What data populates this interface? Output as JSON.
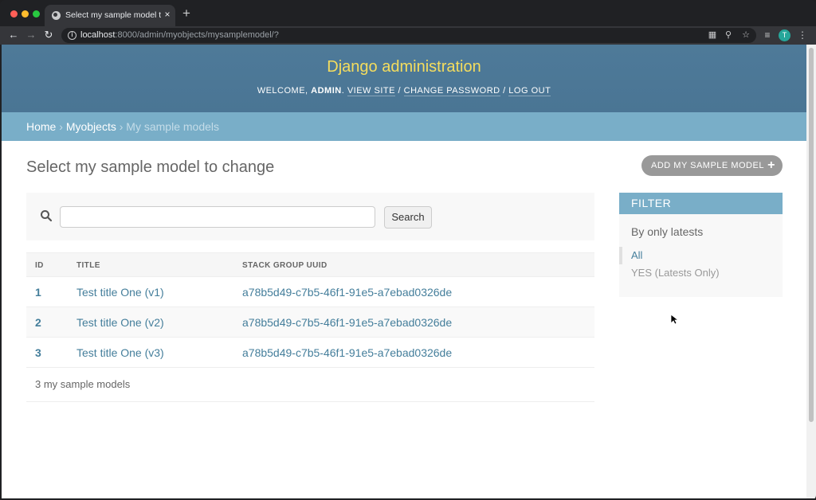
{
  "browser": {
    "tab_title": "Select my sample model to change",
    "tab_close": "×",
    "new_tab": "+",
    "url_host": "localhost",
    "url_rest": ":8000/admin/myobjects/mysamplemodel/?",
    "avatar_letter": "T",
    "icons": [
      "back-icon",
      "forward-icon",
      "reload-icon",
      "info-icon",
      "translate-icon",
      "zoom-icon",
      "star-icon",
      "media-icon",
      "menu-icon"
    ]
  },
  "header": {
    "site_name": "Django administration",
    "welcome": "WELCOME, ",
    "username": "ADMIN",
    "sep0": ". ",
    "view_site": "VIEW SITE",
    "sep1": " / ",
    "change_password": "CHANGE PASSWORD",
    "sep2": " / ",
    "log_out": "LOG OUT"
  },
  "breadcrumbs": {
    "home": "Home",
    "sep": " › ",
    "app": "Myobjects",
    "current": "My sample models"
  },
  "content": {
    "title": "Select my sample model to change",
    "add_button": "ADD MY SAMPLE MODEL",
    "add_icon": "+"
  },
  "search": {
    "value": "",
    "placeholder": "",
    "button": "Search"
  },
  "table": {
    "columns": [
      "ID",
      "TITLE",
      "STACK GROUP UUID"
    ],
    "rows": [
      {
        "id": "1",
        "title": "Test title One (v1)",
        "uuid": "a78b5d49-c7b5-46f1-91e5-a7ebad0326de"
      },
      {
        "id": "2",
        "title": "Test title One (v2)",
        "uuid": "a78b5d49-c7b5-46f1-91e5-a7ebad0326de"
      },
      {
        "id": "3",
        "title": "Test title One (v3)",
        "uuid": "a78b5d49-c7b5-46f1-91e5-a7ebad0326de"
      }
    ],
    "count_text": "3 my sample models"
  },
  "filter": {
    "heading": "FILTER",
    "subheading": "By only latests",
    "options": [
      "All",
      "YES (Latests Only)"
    ],
    "selected": "All"
  },
  "colors": {
    "header_bg": "#4e7a99",
    "site_name": "#f5dd5d",
    "breadcrumb_bg": "#79aec8",
    "link": "#447e9b",
    "add_button_bg": "#999999"
  }
}
